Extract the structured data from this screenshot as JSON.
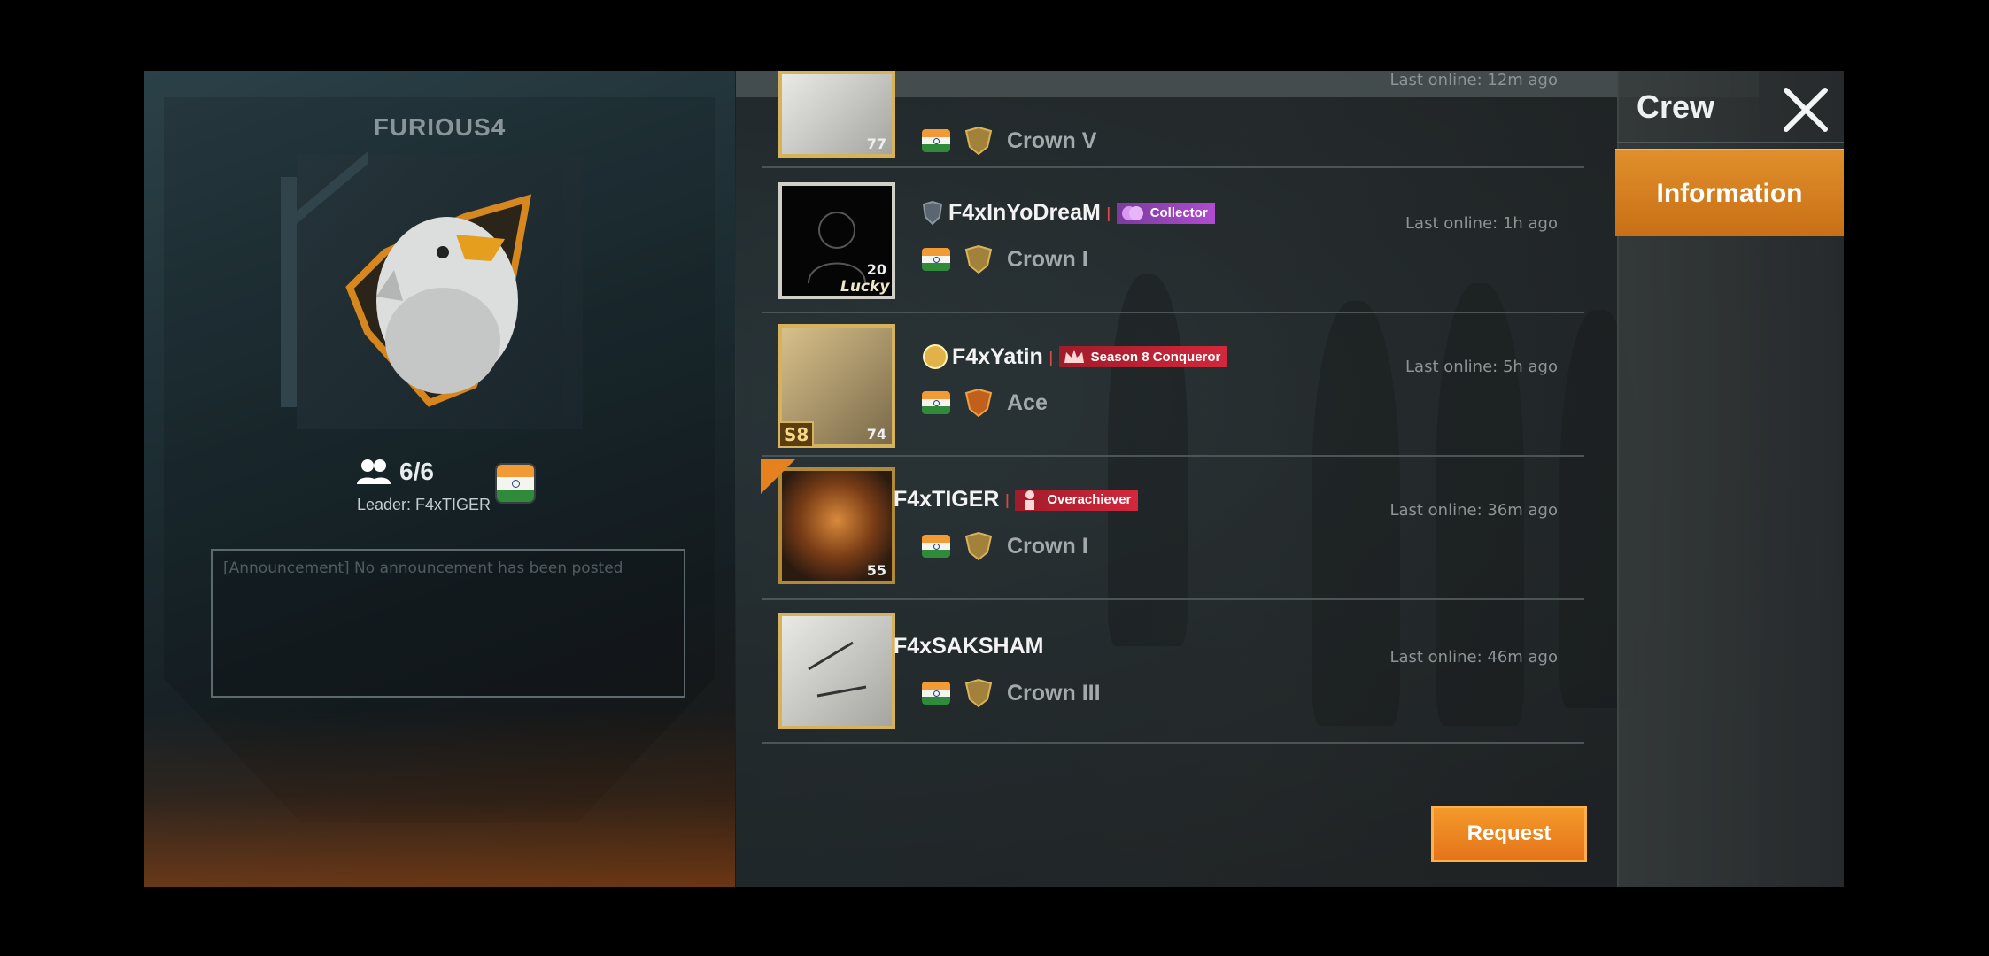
{
  "crew": {
    "name": "FURIOUS4",
    "member_count": "6/6",
    "leader": "Leader: F4xTIGER",
    "announcement": "[Announcement] No announcement has been posted"
  },
  "members": [
    {
      "name": "",
      "tier": "Crown V",
      "badge": "",
      "last_online": "Last online: 12m ago",
      "level": "77"
    },
    {
      "name": "F4xInYoDreaM",
      "tier": "Crown I",
      "badge": "Collector",
      "last_online": "Last online: 1h ago",
      "level": "20"
    },
    {
      "name": "F4xYatin",
      "tier": "Ace",
      "badge": "Season 8 Conqueror",
      "last_online": "Last online: 5h ago",
      "level": "74"
    },
    {
      "name": "F4xTIGER",
      "tier": "Crown I",
      "badge": "Overachiever",
      "last_online": "Last online: 36m ago",
      "level": "55"
    },
    {
      "name": "F4xSAKSHAM",
      "tier": "Crown III",
      "badge": "",
      "last_online": "Last online: 46m ago",
      "level": ""
    }
  ],
  "avatar_labels": {
    "lucky": "Lucky",
    "season": "S8"
  },
  "buttons": {
    "request": "Request"
  },
  "sidebar": {
    "title": "Crew",
    "tab": "Information"
  },
  "icons": {
    "close": "close-icon",
    "members": "people-icon",
    "flag": "india-flag-icon",
    "tier": "tier-crest-icon"
  },
  "colors": {
    "accent": "#e5811f",
    "badge_purple": "#b04bd0",
    "badge_red": "#d3283c"
  }
}
